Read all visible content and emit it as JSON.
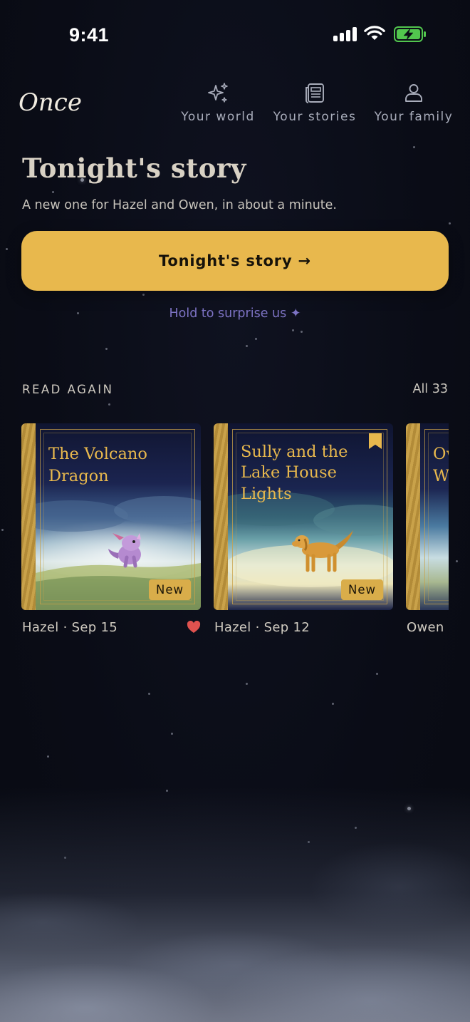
{
  "status_bar": {
    "time": "9:41"
  },
  "header": {
    "brand": "Once",
    "nav": [
      {
        "label": "Your world",
        "icon": "sparkles-icon"
      },
      {
        "label": "Your stories",
        "icon": "newspaper-icon"
      },
      {
        "label": "Your family",
        "icon": "person-icon"
      }
    ]
  },
  "hero": {
    "title": "Tonight's story",
    "subtitle": "A new one for Hazel and Owen, in about a minute.",
    "cta_label": "Tonight's story →",
    "surprise_label": "Hold to surprise us ✦"
  },
  "read_again": {
    "title": "READ AGAIN",
    "all_label": "All 33",
    "books": [
      {
        "title": "The Volcano Dragon",
        "badge": "New",
        "meta": "Hazel · Sep 15",
        "favorited": true,
        "bookmarked": false
      },
      {
        "title": "Sully and the Lake House Lights",
        "badge": "New",
        "meta": "Hazel · Sep 12",
        "favorited": false,
        "bookmarked": true
      },
      {
        "title": "Ow… W…",
        "badge": "",
        "meta": "Owen",
        "favorited": false,
        "bookmarked": false
      }
    ]
  },
  "colors": {
    "background": "#0a0c16",
    "accent_gold": "#e8b84d",
    "surprise_purple": "#7d73c4",
    "heart_red": "#e0524f"
  }
}
